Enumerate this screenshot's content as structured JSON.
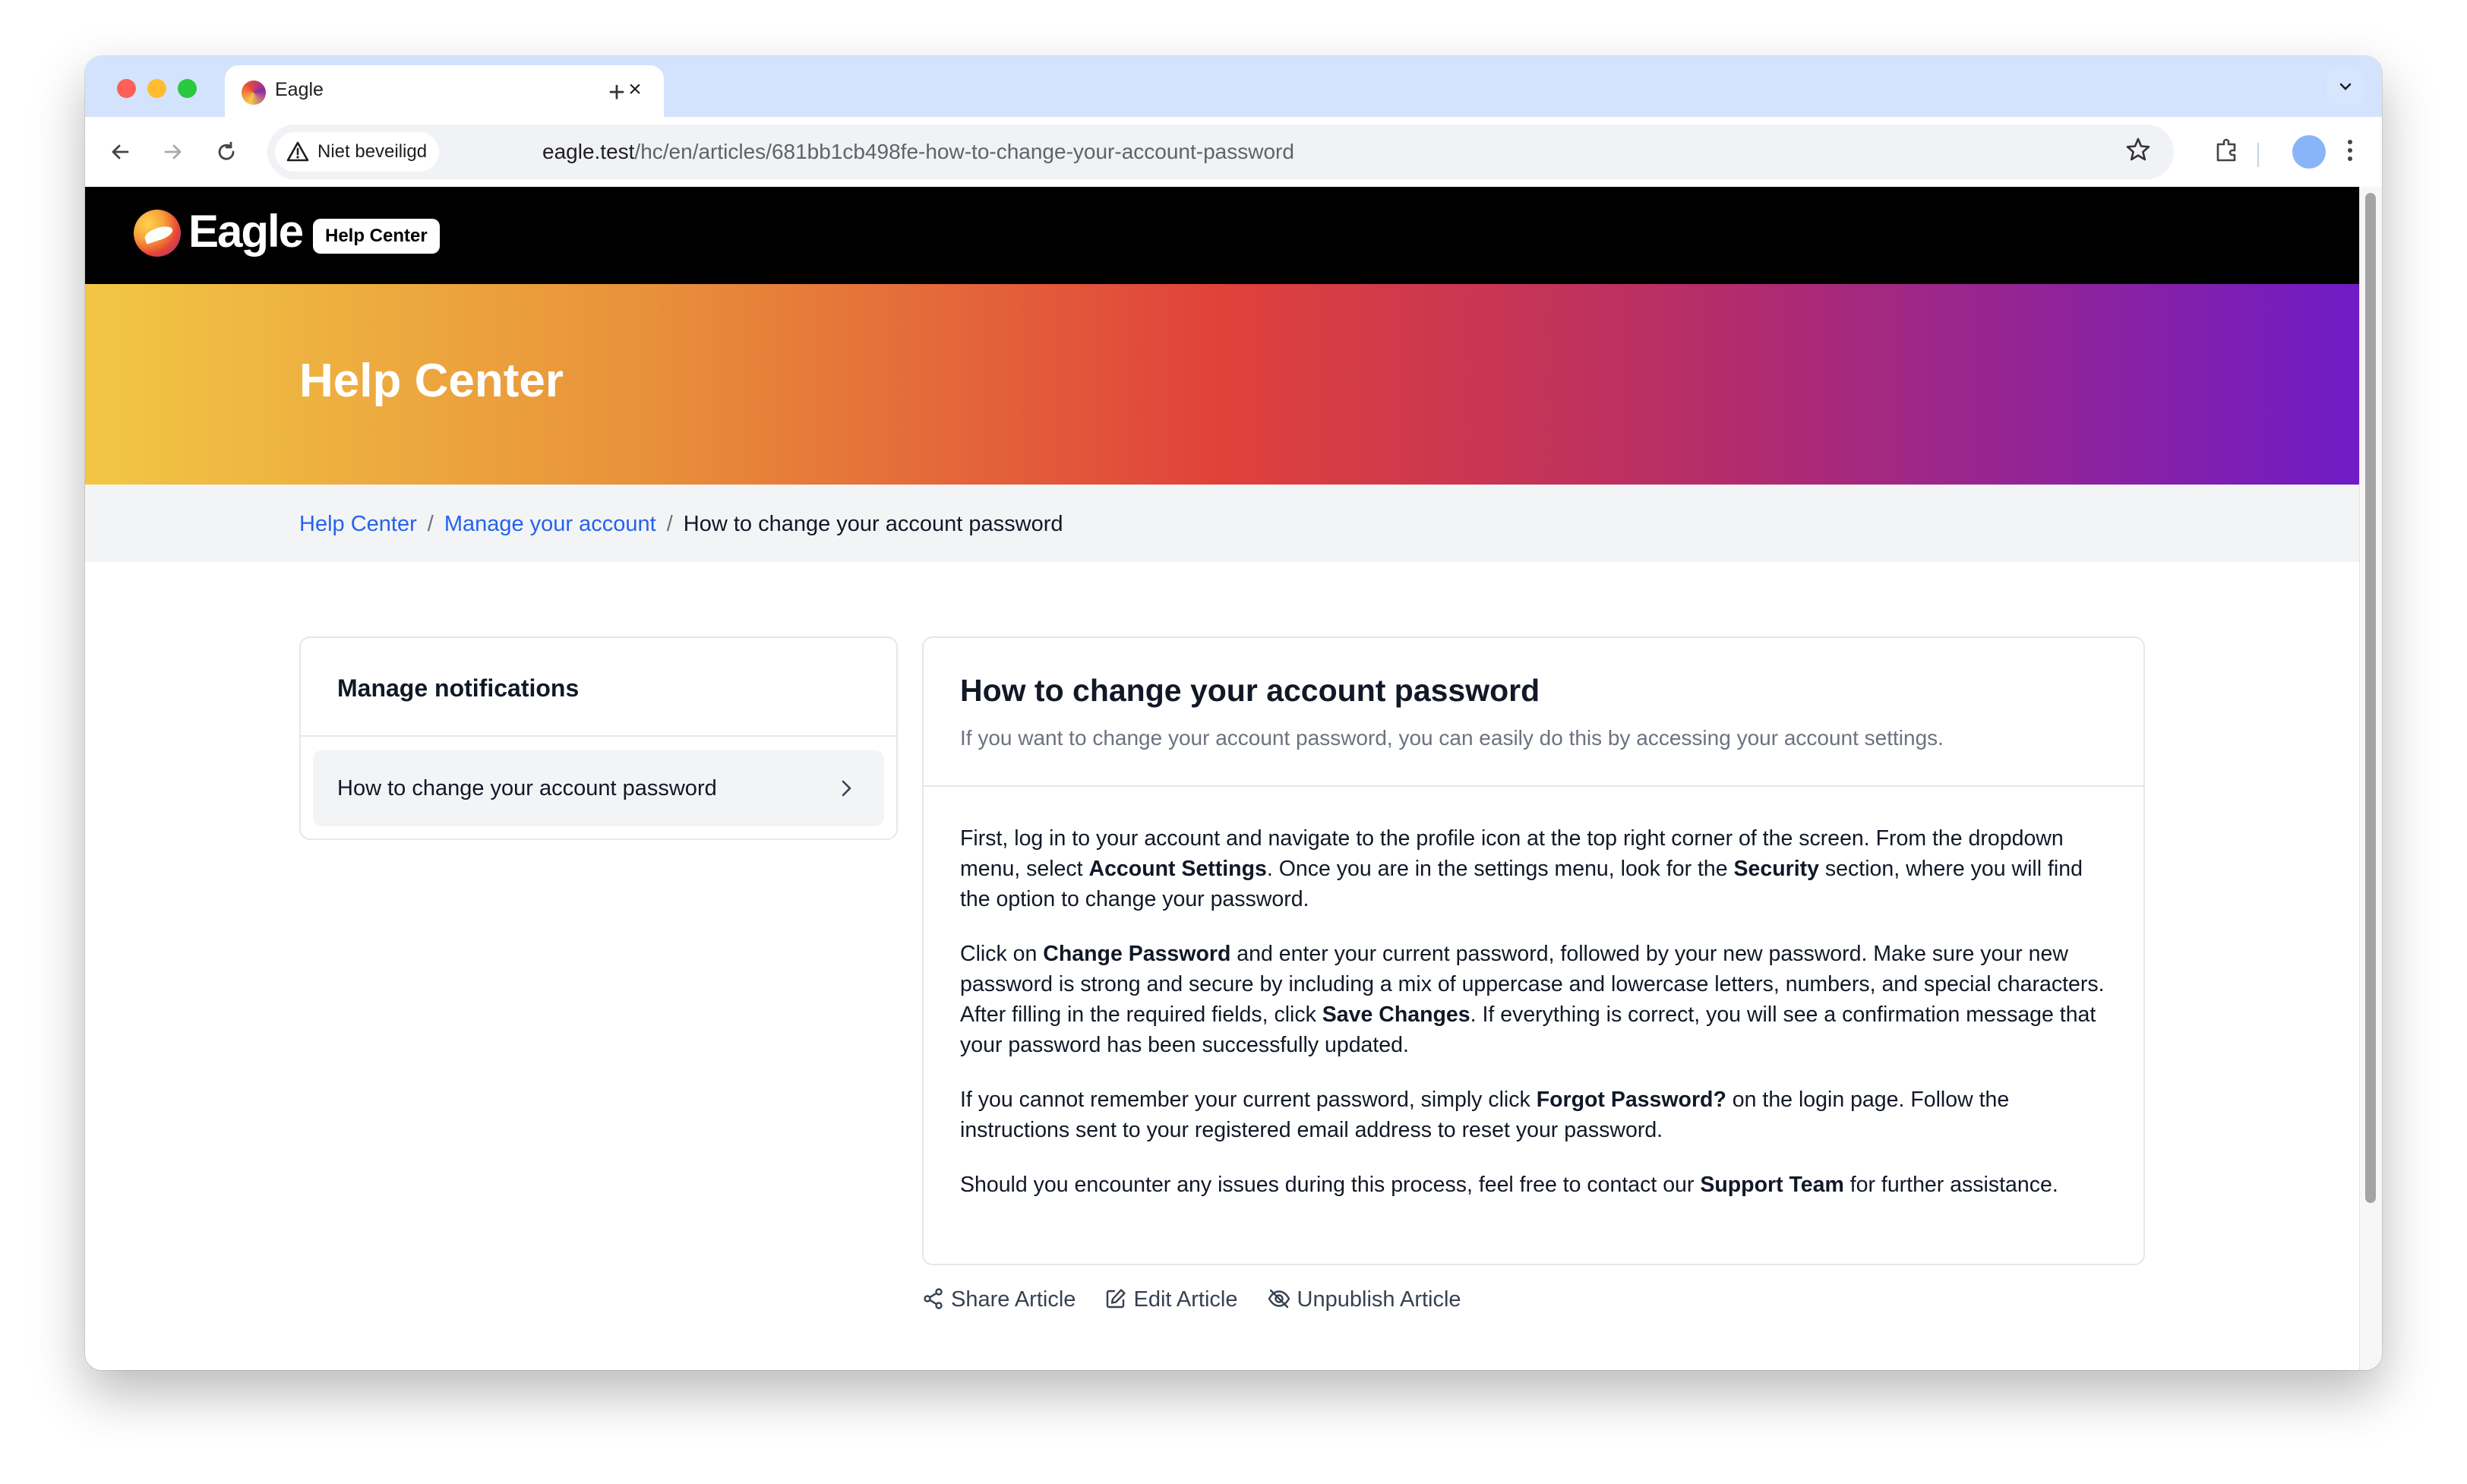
{
  "browser": {
    "tab_title": "Eagle",
    "tab_close": "×",
    "new_tab": "+",
    "security_label": "Niet beveiligd",
    "url_host": "eagle.test",
    "url_path": "/hc/en/articles/681bb1cb498fe-how-to-change-your-account-password"
  },
  "header": {
    "logo_text": "Eagle",
    "badge": "Help Center"
  },
  "hero": {
    "title": "Help Center"
  },
  "breadcrumb": {
    "items": [
      {
        "label": "Help Center"
      },
      {
        "label": "Manage your account"
      },
      {
        "label": "How to change your account password"
      }
    ],
    "separator": "/"
  },
  "sidebar": {
    "title": "Manage notifications",
    "items": [
      {
        "label": "How to change your account password"
      }
    ]
  },
  "article": {
    "title": "How to change your account password",
    "subtitle": "If you want to change your account password, you can easily do this by accessing your account settings.",
    "paragraphs": [
      [
        {
          "t": "First, log in to your account and navigate to the profile icon at the top right corner of the screen. From the dropdown menu, select "
        },
        {
          "t": "Account Settings",
          "b": true
        },
        {
          "t": ". Once you are in the settings menu, look for the "
        },
        {
          "t": "Security",
          "b": true
        },
        {
          "t": " section, where you will find the option to change your password."
        }
      ],
      [
        {
          "t": "Click on "
        },
        {
          "t": "Change Password",
          "b": true
        },
        {
          "t": " and enter your current password, followed by your new password. Make sure your new password is strong and secure by including a mix of uppercase and lowercase letters, numbers, and special characters. After filling in the required fields, click "
        },
        {
          "t": "Save Changes",
          "b": true
        },
        {
          "t": ". If everything is correct, you will see a confirmation message that your password has been successfully updated."
        }
      ],
      [
        {
          "t": "If you cannot remember your current password, simply click "
        },
        {
          "t": "Forgot Password?",
          "b": true
        },
        {
          "t": " on the login page. Follow the instructions sent to your registered email address to reset your password."
        }
      ],
      [
        {
          "t": "Should you encounter any issues during this process, feel free to contact our "
        },
        {
          "t": "Support Team",
          "b": true
        },
        {
          "t": " for further assistance."
        }
      ]
    ]
  },
  "actions": {
    "share": "Share Article",
    "edit": "Edit Article",
    "unpublish": "Unpublish Article"
  },
  "colors": {
    "link": "#2563eb",
    "header_bg": "#000000",
    "hero_gradient": [
      "#f2c744",
      "#e0413a",
      "#6f1bc6"
    ]
  }
}
